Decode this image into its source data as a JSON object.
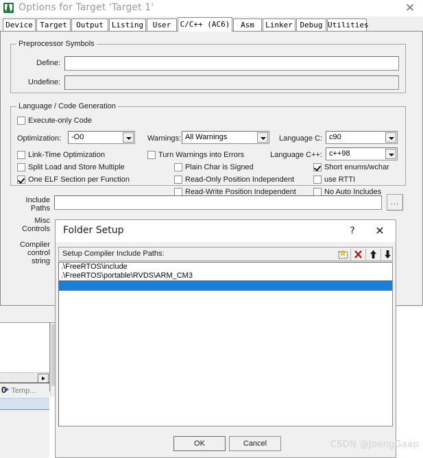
{
  "window": {
    "title": "Options for Target 'Target 1'",
    "icon": "keil-uvision-icon",
    "close_label": "✕"
  },
  "tabs": [
    {
      "label": "Device",
      "selected": false
    },
    {
      "label": "Target",
      "selected": false
    },
    {
      "label": "Output",
      "selected": false
    },
    {
      "label": "Listing",
      "selected": false
    },
    {
      "label": "User",
      "selected": false
    },
    {
      "label": "C/C++ (AC6)",
      "selected": true
    },
    {
      "label": "Asm",
      "selected": false
    },
    {
      "label": "Linker",
      "selected": false
    },
    {
      "label": "Debug",
      "selected": false
    },
    {
      "label": "Utilities",
      "selected": false
    }
  ],
  "preprocessor": {
    "group_label": "Preprocessor Symbols",
    "define_label": "Define:",
    "define_value": "",
    "undefine_label": "Undefine:",
    "undefine_value": ""
  },
  "language": {
    "group_label": "Language / Code Generation",
    "execute_only": {
      "label": "Execute-only Code",
      "checked": false
    },
    "optimization_label": "Optimization:",
    "optimization_value": "-O0",
    "link_time": {
      "label": "Link-Time Optimization",
      "checked": false
    },
    "split_load": {
      "label": "Split Load and Store Multiple",
      "checked": false
    },
    "one_elf": {
      "label": "One ELF Section per Function",
      "checked": true
    },
    "warnings_label": "Warnings:",
    "warnings_value": "All Warnings",
    "turn_warnings": {
      "label": "Turn Warnings into Errors",
      "checked": false
    },
    "plain_char": {
      "label": "Plain Char is Signed",
      "checked": false
    },
    "read_only_pi": {
      "label": "Read-Only Position Independent",
      "checked": false
    },
    "read_write_pi": {
      "label": "Read-Write Position Independent",
      "checked": false
    },
    "language_c_label": "Language C:",
    "language_c_value": "c90",
    "language_cpp_label": "Language C++:",
    "language_cpp_value": "c++98",
    "short_enums": {
      "label": "Short enums/wchar",
      "checked": true
    },
    "use_rtti": {
      "label": "use RTTI",
      "checked": false
    },
    "no_auto_includes": {
      "label": "No Auto Includes",
      "checked": false
    }
  },
  "paths": {
    "include_label_1": "Include",
    "include_label_2": "Paths",
    "include_value": "",
    "browse_label": "...",
    "misc_label_1": "Misc",
    "misc_label_2": "Controls",
    "compiler_label_1": "Compiler",
    "compiler_label_2": "control",
    "compiler_label_3": "string"
  },
  "folder_setup": {
    "title": "Folder Setup",
    "help_label": "?",
    "close_label": "✕",
    "bar_label": "Setup Compiler Include Paths:",
    "toolbar": [
      {
        "name": "new-folder-icon",
        "title": "New"
      },
      {
        "name": "delete-icon",
        "title": "Delete"
      },
      {
        "name": "move-up-icon",
        "title": "Move Up"
      },
      {
        "name": "move-down-icon",
        "title": "Move Down"
      }
    ],
    "items": [
      {
        "text": ".\\FreeRTOS\\include",
        "selected": false
      },
      {
        "text": ".\\FreeRTOS\\portable\\RVDS\\ARM_CM3",
        "selected": false
      },
      {
        "text": "",
        "selected": true
      }
    ],
    "ok_label": "OK",
    "cancel_label": "Cancel"
  },
  "background": {
    "tab_zero": "0",
    "tab_label": "Temp..."
  },
  "watermark": "CSDN @JoengGaap"
}
